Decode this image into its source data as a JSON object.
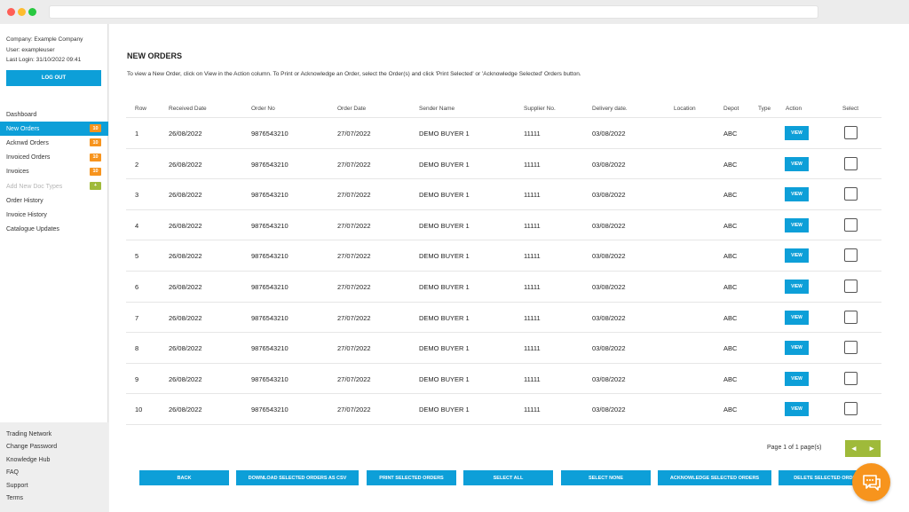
{
  "sidebar": {
    "company": "Company: Example Company",
    "user": "User: exampleuser",
    "last_login": "Last Login: 31/10/2022 09:41",
    "logout_label": "LOG OUT",
    "nav": [
      {
        "label": "Dashboard",
        "badge": ""
      },
      {
        "label": "New Orders",
        "badge": "10"
      },
      {
        "label": "Acknwd Orders",
        "badge": "10"
      },
      {
        "label": "Invoiced Orders",
        "badge": "10"
      },
      {
        "label": "Invoices",
        "badge": "10"
      },
      {
        "label": "Add New Doc Types",
        "badge": "+"
      },
      {
        "label": "Order History",
        "badge": ""
      },
      {
        "label": "Invoice History",
        "badge": ""
      },
      {
        "label": "Catalogue Updates",
        "badge": ""
      }
    ],
    "bottom": [
      "Trading Network",
      "Change Password",
      "Knowledge Hub",
      "FAQ",
      "Support",
      "Terms"
    ]
  },
  "main": {
    "title": "NEW ORDERS",
    "instructions": "To view a New Order, click on View in the Action column. To Print or Acknowledge an Order, select the Order(s) and click 'Print Selected' or 'Acknowledge Selected' Orders button.",
    "columns": [
      "Row",
      "Received Date",
      "Order No",
      "Order Date",
      "Sender Name",
      "Supplier No.",
      "Delivery date.",
      "Location",
      "Depot",
      "Type",
      "Action",
      "Select"
    ],
    "view_label": "VIEW",
    "rows": [
      {
        "row": "1",
        "received": "26/08/2022",
        "order_no": "9876543210",
        "order_date": "27/07/2022",
        "sender": "DEMO BUYER 1",
        "supplier": "11111",
        "delivery": "03/08/2022",
        "location": "",
        "depot": "ABC",
        "type": ""
      },
      {
        "row": "2",
        "received": "26/08/2022",
        "order_no": "9876543210",
        "order_date": "27/07/2022",
        "sender": "DEMO BUYER 1",
        "supplier": "11111",
        "delivery": "03/08/2022",
        "location": "",
        "depot": "ABC",
        "type": ""
      },
      {
        "row": "3",
        "received": "26/08/2022",
        "order_no": "9876543210",
        "order_date": "27/07/2022",
        "sender": "DEMO BUYER 1",
        "supplier": "11111",
        "delivery": "03/08/2022",
        "location": "",
        "depot": "ABC",
        "type": ""
      },
      {
        "row": "4",
        "received": "26/08/2022",
        "order_no": "9876543210",
        "order_date": "27/07/2022",
        "sender": "DEMO BUYER 1",
        "supplier": "11111",
        "delivery": "03/08/2022",
        "location": "",
        "depot": "ABC",
        "type": ""
      },
      {
        "row": "5",
        "received": "26/08/2022",
        "order_no": "9876543210",
        "order_date": "27/07/2022",
        "sender": "DEMO BUYER 1",
        "supplier": "11111",
        "delivery": "03/08/2022",
        "location": "",
        "depot": "ABC",
        "type": ""
      },
      {
        "row": "6",
        "received": "26/08/2022",
        "order_no": "9876543210",
        "order_date": "27/07/2022",
        "sender": "DEMO BUYER 1",
        "supplier": "11111",
        "delivery": "03/08/2022",
        "location": "",
        "depot": "ABC",
        "type": ""
      },
      {
        "row": "7",
        "received": "26/08/2022",
        "order_no": "9876543210",
        "order_date": "27/07/2022",
        "sender": "DEMO BUYER 1",
        "supplier": "11111",
        "delivery": "03/08/2022",
        "location": "",
        "depot": "ABC",
        "type": ""
      },
      {
        "row": "8",
        "received": "26/08/2022",
        "order_no": "9876543210",
        "order_date": "27/07/2022",
        "sender": "DEMO BUYER 1",
        "supplier": "11111",
        "delivery": "03/08/2022",
        "location": "",
        "depot": "ABC",
        "type": ""
      },
      {
        "row": "9",
        "received": "26/08/2022",
        "order_no": "9876543210",
        "order_date": "27/07/2022",
        "sender": "DEMO BUYER 1",
        "supplier": "11111",
        "delivery": "03/08/2022",
        "location": "",
        "depot": "ABC",
        "type": ""
      },
      {
        "row": "10",
        "received": "26/08/2022",
        "order_no": "9876543210",
        "order_date": "27/07/2022",
        "sender": "DEMO BUYER 1",
        "supplier": "11111",
        "delivery": "03/08/2022",
        "location": "",
        "depot": "ABC",
        "type": ""
      }
    ],
    "pager_text": "Page 1 of 1 page(s)",
    "pager_prev": "◂",
    "pager_next": "▸",
    "buttons": [
      "BACK",
      "DOWNLOAD SELECTED ORDERS AS CSV",
      "PRINT SELECTED ORDERS",
      "SELECT ALL",
      "SELECT NONE",
      "ACKNOWLEDGE SELECTED ORDERS",
      "DELETE SELECTED ORDERS"
    ]
  },
  "colors": {
    "accent": "#0d9fd8",
    "badge_orange": "#f7941d",
    "badge_green": "#9fba3a",
    "chat": "#f7941d"
  }
}
